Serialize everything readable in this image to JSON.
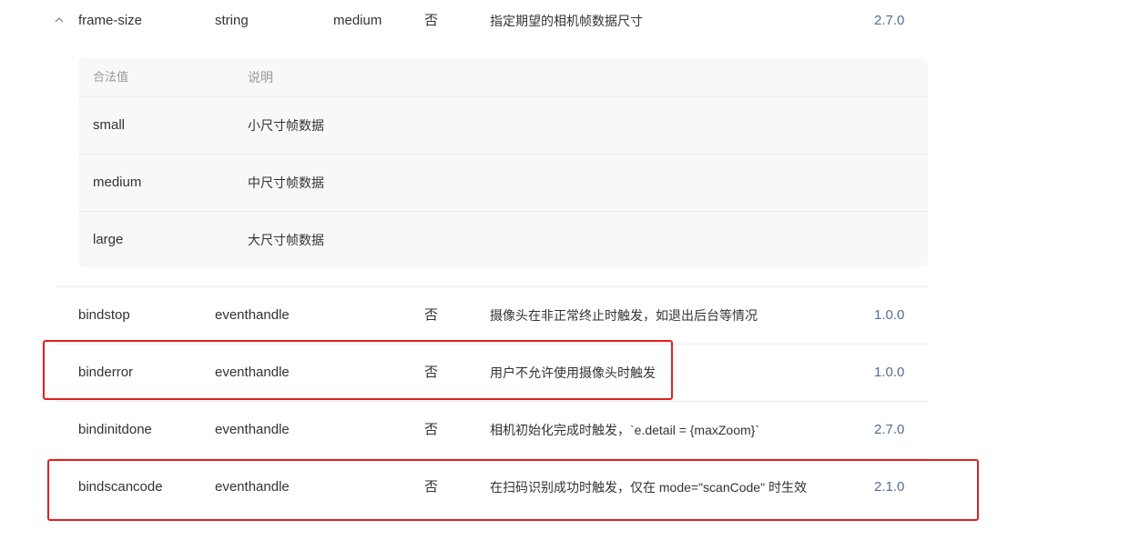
{
  "attr_row": {
    "name": "frame-size",
    "type": "string",
    "default": "medium",
    "required": "否",
    "description": "指定期望的相机帧数据尺寸",
    "version": "2.7.0",
    "expand_icon": "chevron-up-icon"
  },
  "subtable": {
    "col_value": "合法值",
    "col_desc": "说明",
    "rows": [
      {
        "value": "small",
        "desc": "小尺寸帧数据"
      },
      {
        "value": "medium",
        "desc": "中尺寸帧数据"
      },
      {
        "value": "large",
        "desc": "大尺寸帧数据"
      }
    ]
  },
  "rows": [
    {
      "name": "bindstop",
      "type": "eventhandle",
      "required": "否",
      "description": "摄像头在非正常终止时触发，如退出后台等情况",
      "version": "1.0.0"
    },
    {
      "name": "binderror",
      "type": "eventhandle",
      "required": "否",
      "description": "用户不允许使用摄像头时触发",
      "version": "1.0.0"
    },
    {
      "name": "bindinitdone",
      "type": "eventhandle",
      "required": "否",
      "description": "相机初始化完成时触发，`e.detail = {maxZoom}`",
      "version": "2.7.0"
    },
    {
      "name": "bindscancode",
      "type": "eventhandle",
      "required": "否",
      "description": "在扫码识别成功时触发，仅在 mode=\"scanCode\" 时生效",
      "version": "2.1.0"
    }
  ],
  "highlight_color": "#e02020"
}
